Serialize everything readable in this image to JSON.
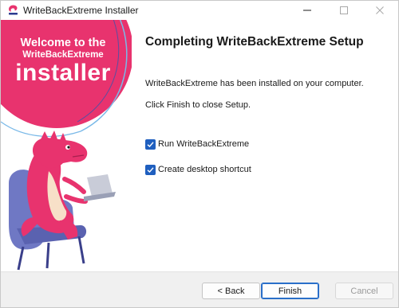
{
  "window": {
    "title": "WriteBackExtreme Installer",
    "app_icon": "writebackextreme-logo-icon",
    "controls": {
      "minimize": "minimize-icon",
      "maximize": "maximize-icon",
      "close": "close-icon"
    }
  },
  "banner": {
    "line1": "Welcome to the",
    "line2": "WriteBackExtreme",
    "line3": "installer",
    "accent_color": "#e8336e",
    "mascot": "dinosaur-on-chair-with-laptop"
  },
  "main": {
    "title": "Completing WriteBackExtreme Setup",
    "message1": "WriteBackExtreme has been installed on your computer.",
    "message2": "Click Finish to close Setup."
  },
  "options": [
    {
      "label": "Run WriteBackExtreme",
      "checked": true
    },
    {
      "label": "Create desktop shortcut",
      "checked": true
    }
  ],
  "footer": {
    "back_label": "< Back",
    "finish_label": "Finish",
    "cancel_label": "Cancel",
    "cancel_disabled": true
  }
}
